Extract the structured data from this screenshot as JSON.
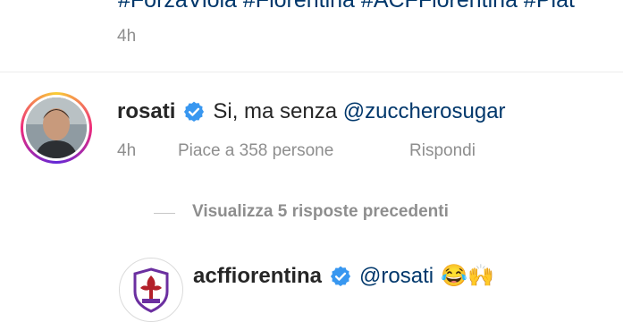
{
  "prev_comment": {
    "hashtags": "#ForzaViola #Fiorentina #ACFFiorentina #Plat",
    "time": "4h"
  },
  "comment": {
    "username": "rosati",
    "text_plain": "Si, ma senza ",
    "mention": "@zuccherosugar",
    "time": "4h",
    "likes": "Piace a 358 persone",
    "reply_label": "Rispondi"
  },
  "replies": {
    "view_label": "Visualizza 5 risposte precedenti"
  },
  "reply": {
    "username": "acffiorentina",
    "mention": "@rosati",
    "emoji": "😂🙌"
  },
  "colors": {
    "mention": "#00376b",
    "verified": "#3897f0",
    "viola": "#6b2fa0"
  },
  "icons": [
    "verified-badge-icon",
    "user-avatar",
    "fiorentina-logo"
  ]
}
